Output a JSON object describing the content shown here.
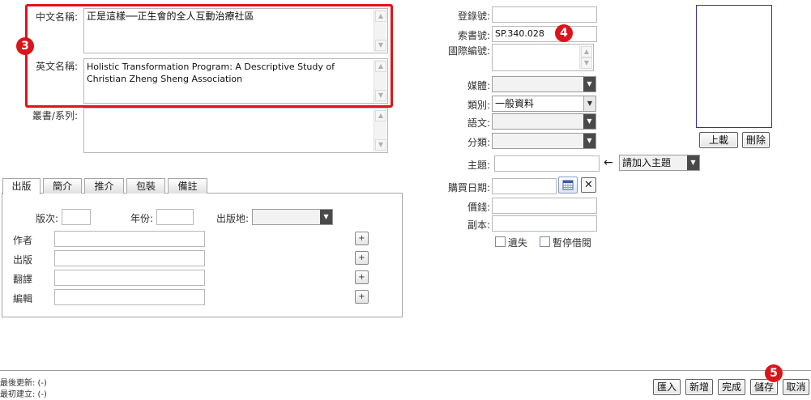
{
  "left_form": {
    "chinese_name_label": "中文名稱:",
    "chinese_name_value": "正是這樣──正生會的全人互動治療社區",
    "english_name_label": "英文名稱:",
    "english_name_value": "Holistic Transformation Program: A Descriptive Study of Christian Zheng Sheng Association",
    "series_label": "叢書/系列:",
    "series_value": ""
  },
  "badges": {
    "b3": "3",
    "b4": "4",
    "b5": "5"
  },
  "tabs": [
    {
      "label": "出版",
      "active": true
    },
    {
      "label": "簡介",
      "active": false
    },
    {
      "label": "推介",
      "active": false
    },
    {
      "label": "包裝",
      "active": false
    },
    {
      "label": "備註",
      "active": false
    }
  ],
  "publish_tab": {
    "edition_label": "版次:",
    "year_label": "年份:",
    "place_label": "出版地:",
    "place_value": "",
    "author_label": "作者",
    "publisher_label": "出版",
    "translator_label": "翻譯",
    "editor_label": "編輯",
    "plus": "+"
  },
  "right_form": {
    "reg_no_label": "登錄號:",
    "reg_no_value": "",
    "call_no_label": "索書號:",
    "call_no_value": "SP.340.028",
    "intl_no_label": "國際編號:",
    "media_label": "媒體:",
    "media_value": "",
    "category_label": "類別:",
    "category_value": "一般資料",
    "language_label": "語文:",
    "language_value": "",
    "classification_label": "分類:",
    "classification_value": "",
    "subject_label": "主題:",
    "subject_value": "",
    "add_subject_option": "請加入主題",
    "purchase_date_label": "購買日期:",
    "price_label": "價錢:",
    "copies_label": "副本:",
    "lost_label": "遺失",
    "suspend_label": "暫停借閱"
  },
  "image_panel": {
    "upload": "上載",
    "delete": "刪除"
  },
  "footer": {
    "last_updated": "最後更新:  (-)",
    "created": "最初建立:  (-)",
    "import": "匯入",
    "new": "新增",
    "done": "完成",
    "save": "儲存",
    "cancel": "取消"
  },
  "colors": {
    "highlight": "#e0141a",
    "badge": "#d9151b",
    "image_border": "#3a2ea0"
  }
}
